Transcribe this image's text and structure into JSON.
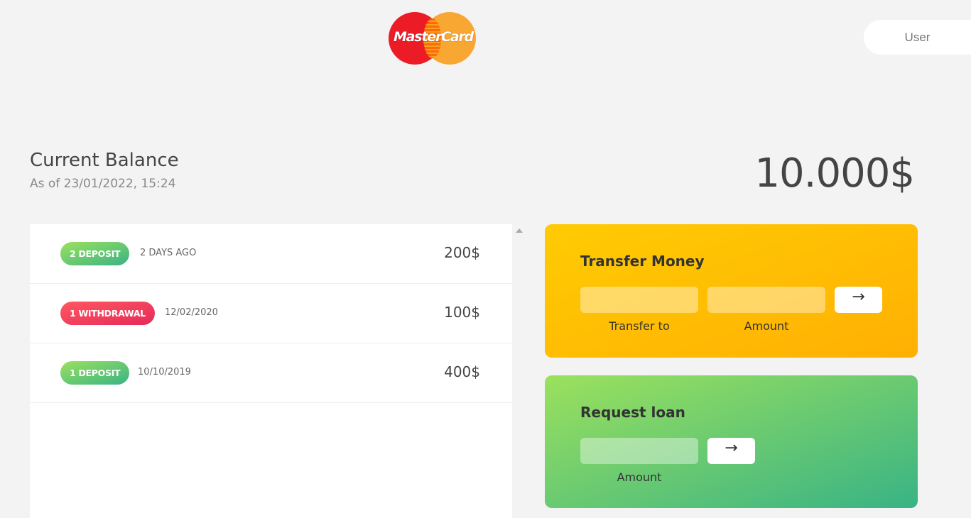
{
  "brand": {
    "logo_text": "MasterCard"
  },
  "header": {
    "user_label": "User"
  },
  "balance": {
    "title": "Current Balance",
    "date_prefix": "As of",
    "date": "23/01/2022, 15:24",
    "date_line": "As of 23/01/2022, 15:24",
    "value": "10.000$"
  },
  "movements": [
    {
      "badge": "2 DEPOSIT",
      "type": "deposit",
      "date": "2 DAYS AGO",
      "amount": "200$"
    },
    {
      "badge": "1 WITHDRAWAL",
      "type": "withdrawal",
      "date": "12/02/2020",
      "amount": "100$"
    },
    {
      "badge": "1 DEPOSIT",
      "type": "deposit",
      "date": "10/10/2019",
      "amount": "400$"
    }
  ],
  "transfer": {
    "title": "Transfer Money",
    "to_label": "Transfer to",
    "amount_label": "Amount",
    "submit_icon": "→"
  },
  "loan": {
    "title": "Request loan",
    "amount_label": "Amount",
    "submit_icon": "→"
  },
  "colors": {
    "background": "#f3f3f3",
    "deposit_gradient": [
      "#9be15d",
      "#39b385"
    ],
    "withdrawal_gradient": [
      "#ff585f",
      "#e52a5a"
    ],
    "transfer_gradient": [
      "#ffcb03",
      "#ffb003"
    ]
  }
}
